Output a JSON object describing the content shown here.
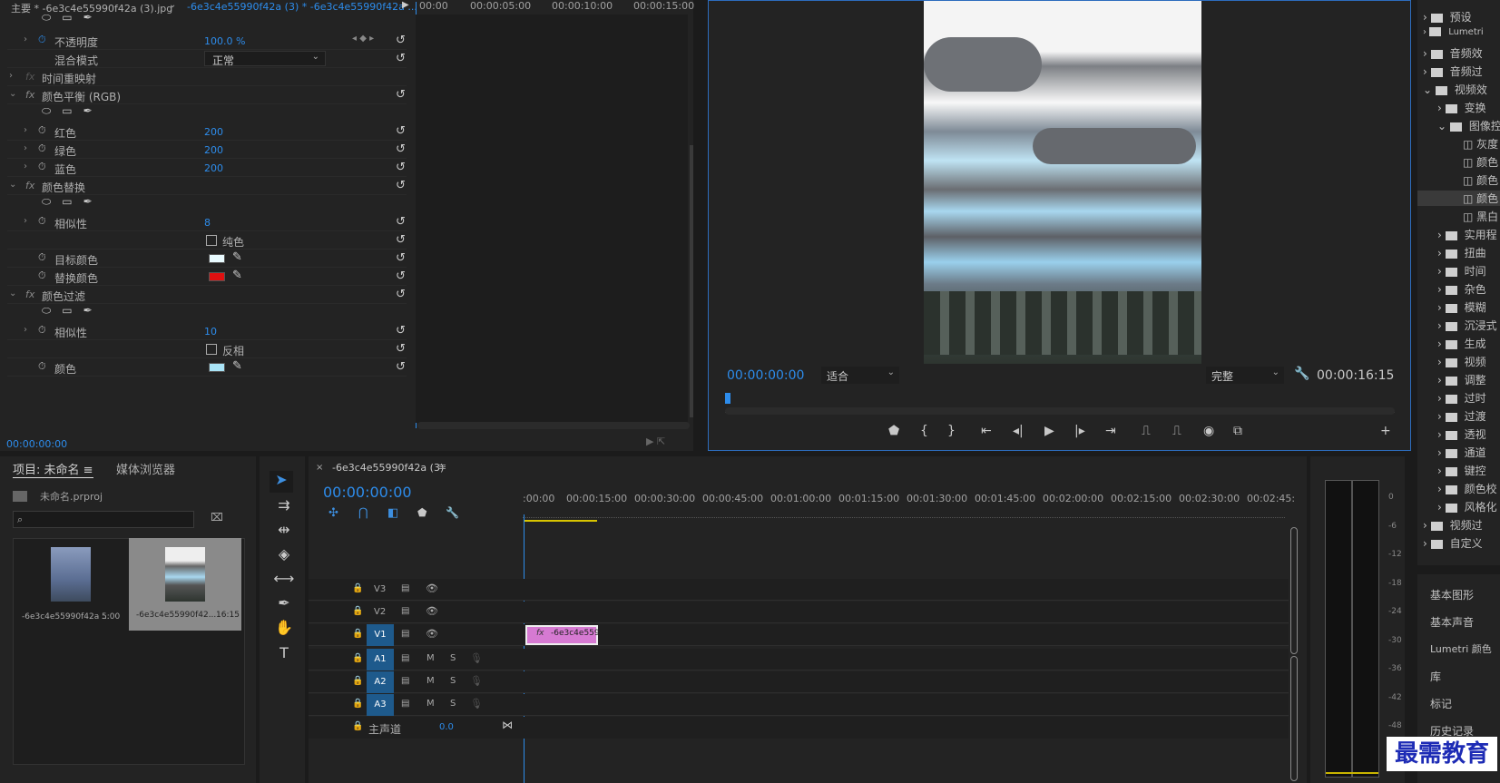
{
  "effects": {
    "tab1": "主要 * -6e3c4e55990f42a (3).jpg",
    "tab2": "-6e3c4e55990f42a (3) * -6e3c4e55990f42a ...",
    "ruler": [
      "00:00",
      "00:00:05:00",
      "00:00:10:00",
      "00:00:15:00"
    ],
    "opacity_label": "不透明度",
    "opacity_value": "100.0 %",
    "blend_label": "混合模式",
    "blend_value": "正常",
    "time_remap": "时间重映射",
    "color_balance": "颜色平衡 (RGB)",
    "red_label": "红色",
    "red_value": "200",
    "green_label": "绿色",
    "green_value": "200",
    "blue_label": "蓝色",
    "blue_value": "200",
    "color_replace": "颜色替换",
    "similarity_label": "相似性",
    "similarity_value": "8",
    "solid_label": "纯色",
    "target_color": "目标颜色",
    "replace_color": "替换颜色",
    "color_pass": "颜色过滤",
    "similarity2_label": "相似性",
    "similarity2_value": "10",
    "invert_label": "反相",
    "color_label": "颜色",
    "timecode": "00:00:00:00"
  },
  "program": {
    "timecode": "00:00:00:00",
    "fit": "适合",
    "quality": "完整",
    "duration": "00:00:16:15"
  },
  "project": {
    "tab_project": "项目: 未命名",
    "tab_media": "媒体浏览器",
    "file": "未命名.prproj",
    "item1_name": "-6e3c4e55990f42a ...",
    "item1_dur": "5:00",
    "item2_name": "-6e3c4e55990f42...",
    "item2_dur": "16:15"
  },
  "timeline": {
    "tab": "-6e3c4e55990f42a (3)",
    "timecode": "00:00:00:00",
    "ruler": [
      ":00:00",
      "00:00:15:00",
      "00:00:30:00",
      "00:00:45:00",
      "00:01:00:00",
      "00:01:15:00",
      "00:01:30:00",
      "00:01:45:00",
      "00:02:00:00",
      "00:02:15:00",
      "00:02:30:00",
      "00:02:45:"
    ],
    "tracks": {
      "v3": "V3",
      "v2": "V2",
      "v1": "V1",
      "a1": "A1",
      "a2": "A2",
      "a3": "A3"
    },
    "m": "M",
    "s": "S",
    "master": "主声道",
    "master_val": "0.0",
    "clip": "-6e3c4e559"
  },
  "meter": [
    "0",
    "-6",
    "-12",
    "-18",
    "-24",
    "-30",
    "-36",
    "-42",
    "-48"
  ],
  "effects_panel": {
    "items": [
      "预设",
      "Lumetri",
      "音频效",
      "音频过",
      "视频效",
      "变换",
      "图像控",
      "灰度",
      "颜色",
      "颜色",
      "颜色",
      "黑白",
      "实用程",
      "扭曲",
      "时间",
      "杂色",
      "模糊",
      "沉浸式",
      "生成",
      "视频",
      "调整",
      "过时",
      "过渡",
      "透视",
      "通道",
      "键控",
      "颜色校",
      "风格化",
      "视频过",
      "自定义"
    ],
    "panels": [
      "基本图形",
      "基本声音",
      "Lumetri 颜色",
      "库",
      "标记",
      "历史记录"
    ]
  },
  "watermark": "最需教育"
}
